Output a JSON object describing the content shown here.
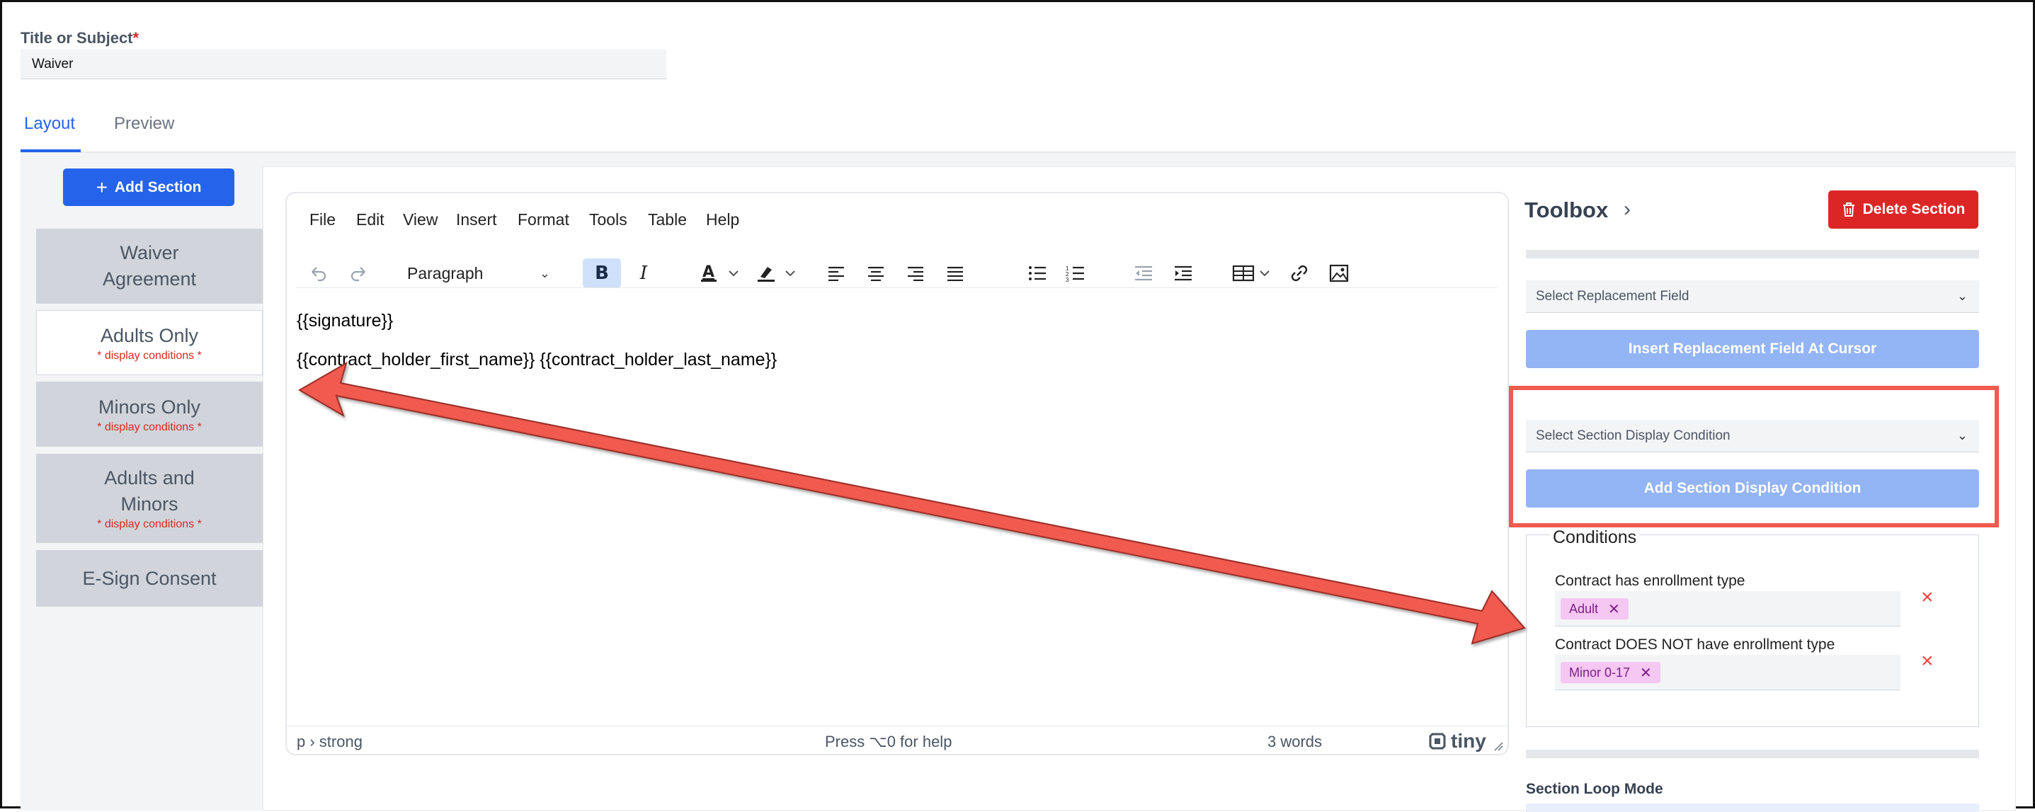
{
  "title_field": {
    "label": "Title or Subject",
    "required_mark": "*",
    "value": "Waiver"
  },
  "tabs": [
    {
      "label": "Layout",
      "active": true
    },
    {
      "label": "Preview",
      "active": false
    }
  ],
  "add_section_label": "Add Section",
  "sections": [
    {
      "label_line1": "Waiver",
      "label_line2": "Agreement",
      "condition_note": ""
    },
    {
      "label_line1": "Adults Only",
      "label_line2": "",
      "condition_note": "* display conditions *",
      "active": true
    },
    {
      "label_line1": "Minors Only",
      "label_line2": "",
      "condition_note": "* display conditions *"
    },
    {
      "label_line1": "Adults and",
      "label_line2": "Minors",
      "condition_note": "* display conditions *"
    },
    {
      "label_line1": "E-Sign Consent",
      "label_line2": "",
      "condition_note": ""
    }
  ],
  "editor": {
    "menu": [
      "File",
      "Edit",
      "View",
      "Insert",
      "Format",
      "Tools",
      "Table",
      "Help"
    ],
    "block_format": "Paragraph",
    "content_lines": [
      "{{signature}}",
      "{{contract_holder_first_name}} {{contract_holder_last_name}}"
    ],
    "status_path": "p › strong",
    "status_help": "Press ⌥0 for help",
    "word_count": "3 words",
    "brand": "tiny"
  },
  "toolbox": {
    "title": "Toolbox",
    "delete_label": "Delete Section",
    "replacement_placeholder": "Select Replacement Field",
    "insert_replacement_label": "Insert Replacement Field At Cursor",
    "display_condition_placeholder": "Select Section Display Condition",
    "add_condition_label": "Add Section Display Condition",
    "conditions_title": "Conditions",
    "conditions": [
      {
        "label": "Contract has enrollment type",
        "chip": "Adult"
      },
      {
        "label": "Contract DOES NOT have enrollment type",
        "chip": "Minor 0-17"
      }
    ],
    "loop_mode_label": "Section Loop Mode"
  },
  "colors": {
    "primary": "#2563eb",
    "danger": "#dc2626",
    "chip_bg": "#f5c7f2",
    "annotation": "#f15a4f"
  }
}
